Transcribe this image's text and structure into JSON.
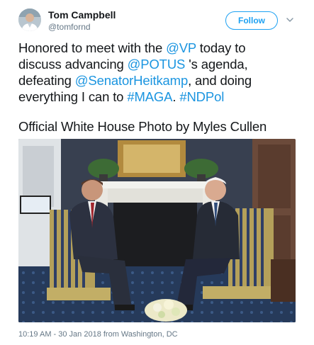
{
  "author": {
    "display_name": "Tom Campbell",
    "handle": "@tomfornd",
    "avatar_icon": "user-avatar"
  },
  "follow_button": {
    "label": "Follow",
    "color": "#1da1f2"
  },
  "more_icon": "chevron-down-icon",
  "tweet": {
    "line1": {
      "a": "Honored to meet with the ",
      "b": "@VP",
      "c": " today to"
    },
    "line2": {
      "a": "discuss advancing ",
      "b": "@POTUS",
      "c": " 's agenda,"
    },
    "line3": {
      "a": "defeating ",
      "b": "@SenatorHeitkamp",
      "c": ", and doing"
    },
    "line4": {
      "a": "everything I can to ",
      "b": "#MAGA",
      "c": ". ",
      "d": "#NDPol"
    }
  },
  "photo_credit": "Official White House Photo by Myles Cullen",
  "photo": {
    "description_icon": "meeting-photo"
  },
  "timestamp": {
    "time_date": "10:19 AM - 30 Jan 2018 from ",
    "location": "Washington, DC"
  },
  "colors": {
    "link": "#1b95e0",
    "text": "#14171a",
    "secondary": "#657786"
  }
}
